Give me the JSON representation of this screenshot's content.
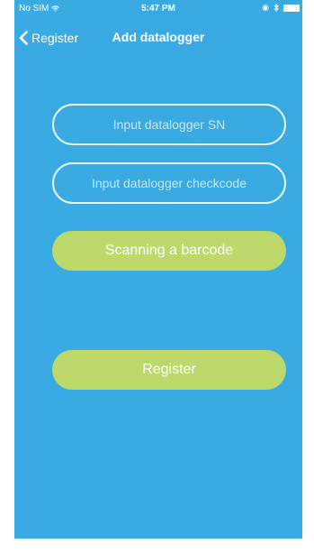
{
  "status_bar": {
    "carrier": "No SIM",
    "time": "5:47 PM"
  },
  "nav": {
    "back_label": "Register",
    "title": "Add datalogger"
  },
  "form": {
    "sn_placeholder": "Input datalogger SN",
    "sn_value": "",
    "checkcode_placeholder": "Input datalogger checkcode",
    "checkcode_value": "",
    "scan_label": "Scanning a barcode",
    "register_label": "Register"
  },
  "colors": {
    "background": "#3aaae3",
    "button": "#bdd86b",
    "field_border": "#eaf6fc"
  },
  "icons": {
    "wifi": "wifi-icon",
    "back": "chevron-left-icon",
    "location": "location-icon",
    "bluetooth": "bluetooth-icon",
    "battery": "battery-icon"
  }
}
